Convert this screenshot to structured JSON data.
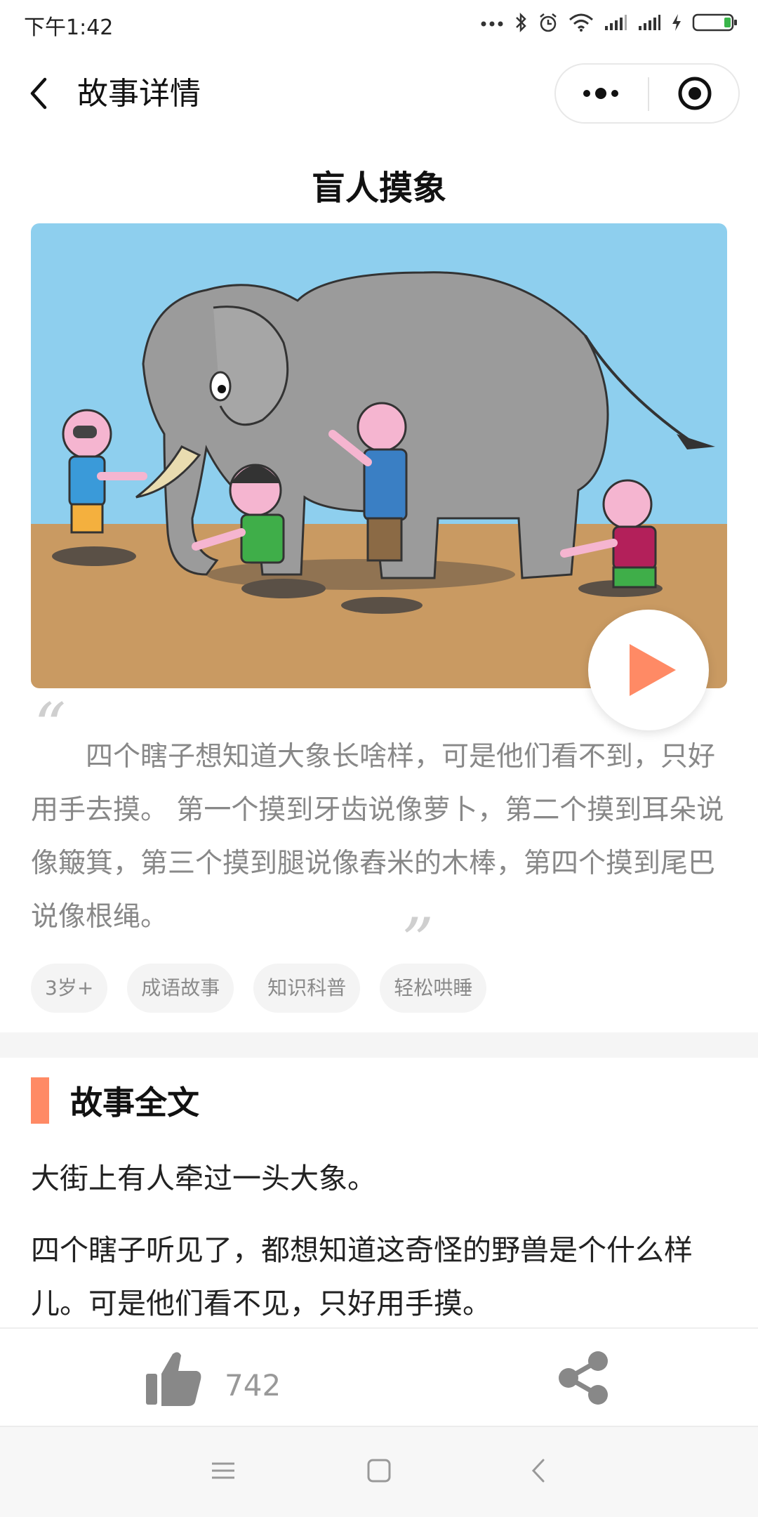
{
  "status_bar": {
    "time": "下午1:42",
    "icons": [
      "dots-icon",
      "bluetooth-icon",
      "alarm-icon",
      "wifi-icon",
      "signal-icon",
      "signal-icon-2",
      "charging-icon",
      "battery-icon"
    ]
  },
  "header": {
    "title": "故事详情",
    "back_icon": "chevron-left-icon",
    "more_icon": "more-dots-icon",
    "close_icon": "target-icon"
  },
  "story": {
    "title": "盲人摸象",
    "summary": "四个瞎子想知道大象长啥样，可是他们看不到，只好用手去摸。 第一个摸到牙齿说像萝卜，第二个摸到耳朵说像簸箕，第三个摸到腿说像舂米的木棒，第四个摸到尾巴说像根绳。",
    "quote_open": "“",
    "quote_close": "”",
    "tags": [
      "3岁+",
      "成语故事",
      "知识科普",
      "轻松哄睡"
    ]
  },
  "full_text": {
    "heading": "故事全文",
    "paragraphs": [
      "大街上有人牵过一头大象。",
      "四个瞎子听见了，都想知道这奇怪的野兽是个什么样儿。可是他们看不见，只好用手摸。"
    ]
  },
  "actions": {
    "like_count": "742",
    "like_icon": "thumbs-up-icon",
    "share_icon": "share-icon"
  },
  "system_nav": {
    "icons": [
      "menu-icon",
      "home-icon",
      "back-icon"
    ]
  },
  "colors": {
    "accent": "#ff8a65",
    "sky": "#8ecfee",
    "ground": "#c99a62",
    "elephant": "#9b9b9b"
  }
}
